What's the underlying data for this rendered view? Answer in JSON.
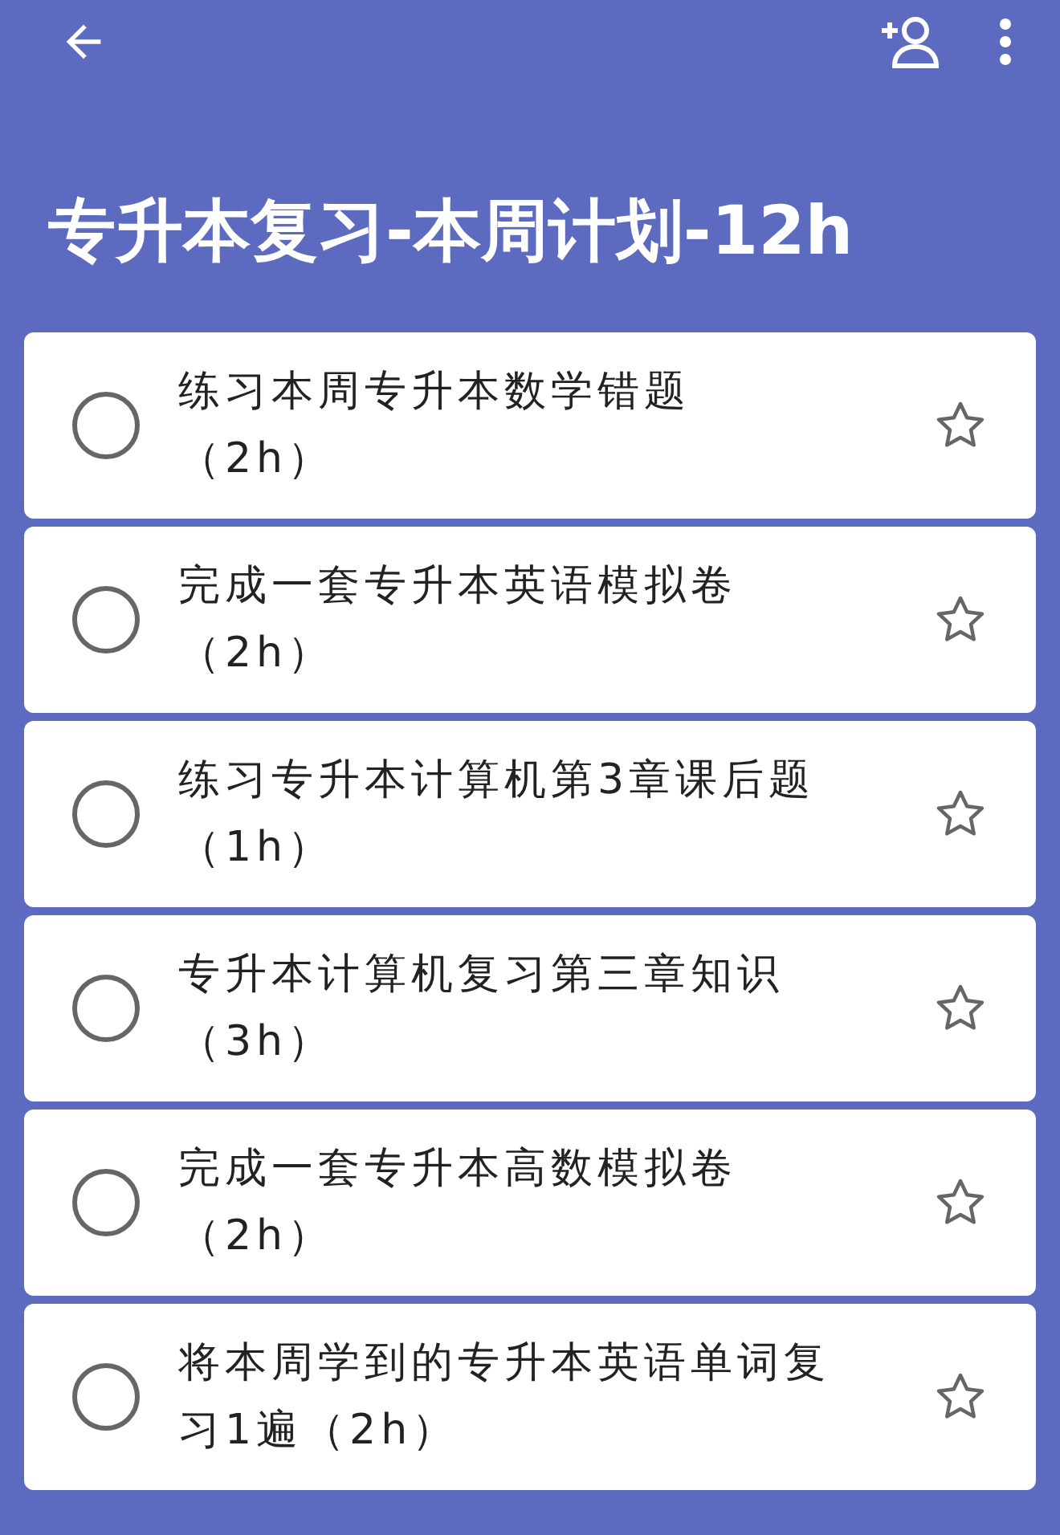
{
  "title": "专升本复习-本周计划-12h",
  "tasks": [
    {
      "lines": [
        "练习本周专升本数学错题",
        "（2h）"
      ],
      "checked": false,
      "starred": false
    },
    {
      "lines": [
        "完成一套专升本英语模拟卷",
        "（2h）"
      ],
      "checked": false,
      "starred": false
    },
    {
      "lines": [
        "练习专升本计算机第3章课后题",
        "（1h）"
      ],
      "checked": false,
      "starred": false
    },
    {
      "lines": [
        "专升本计算机复习第三章知识",
        "（3h）"
      ],
      "checked": false,
      "starred": false
    },
    {
      "lines": [
        "完成一套专升本高数模拟卷",
        "（2h）"
      ],
      "checked": false,
      "starred": false
    },
    {
      "lines": [
        "将本周学到的专升本英语单词复",
        "习1遍（2h）"
      ],
      "checked": false,
      "starred": false
    }
  ]
}
